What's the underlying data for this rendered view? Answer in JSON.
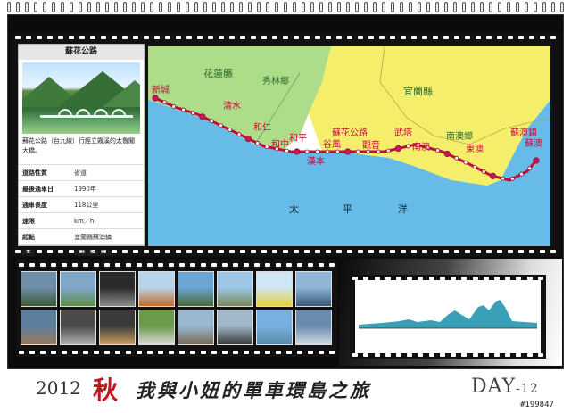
{
  "card": {
    "title": "蘇花公路",
    "caption": "蘇花公路（台九線）行經立霧溪的太魯閣大橋。",
    "rows": [
      {
        "k": "道路性質",
        "v": "省道"
      },
      {
        "k": "最後通車日",
        "v": "1990年"
      },
      {
        "k": "通車長度",
        "v": "118公里"
      },
      {
        "k": "速限",
        "v": "km／h"
      },
      {
        "k": "起點",
        "v": "宜蘭縣蘇澳鎮"
      },
      {
        "k": "終點",
        "v": "花蓮縣花蓮市"
      }
    ]
  },
  "map": {
    "county_hualien": "花蓮縣",
    "county_yilan": "宜蘭縣",
    "township_xiulin": "秀林鄉",
    "road_name": "蘇花公路",
    "sea_1": "太",
    "sea_2": "平",
    "sea_3": "洋",
    "places": {
      "xincheng": "新城",
      "qingshui": "清水",
      "heren": "和仁",
      "hezhong": "和中",
      "heping": "和平",
      "gu": "谷風",
      "hanben": "漢本",
      "guanyin": "觀音",
      "wuta": "武塔",
      "nanao": "南澳",
      "nanao_town": "南澳鄉",
      "dongao": "東澳",
      "suao": "蘇澳",
      "suao_town": "蘇澳鎮"
    }
  },
  "bottom": {
    "year": "2012",
    "autumn": "秋",
    "slogan": "我與小妞的單車環島之旅",
    "day": "DAY",
    "day_num": "-12",
    "watermark": "#199847"
  }
}
